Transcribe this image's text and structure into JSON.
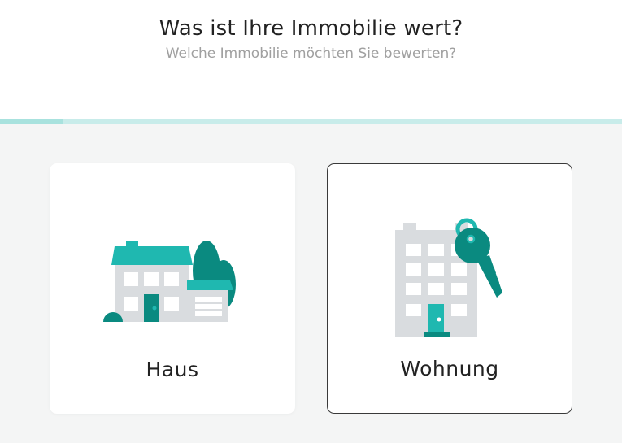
{
  "header": {
    "title": "Was ist Ihre Immobilie wert?",
    "subtitle": "Welche Immobilie möchten Sie bewerten?"
  },
  "progress": {
    "value": 0.1
  },
  "options": [
    {
      "label": "Haus",
      "icon": "house-icon",
      "selected": false
    },
    {
      "label": "Wohnung",
      "icon": "apartment-key-icon",
      "selected": true
    }
  ],
  "colors": {
    "teal_light": "#1fb8b0",
    "teal_dark": "#0a8a80",
    "building_gray": "#d9dcdf",
    "progress_track": "#c8ecea",
    "selected_border": "#3a3a3a"
  }
}
